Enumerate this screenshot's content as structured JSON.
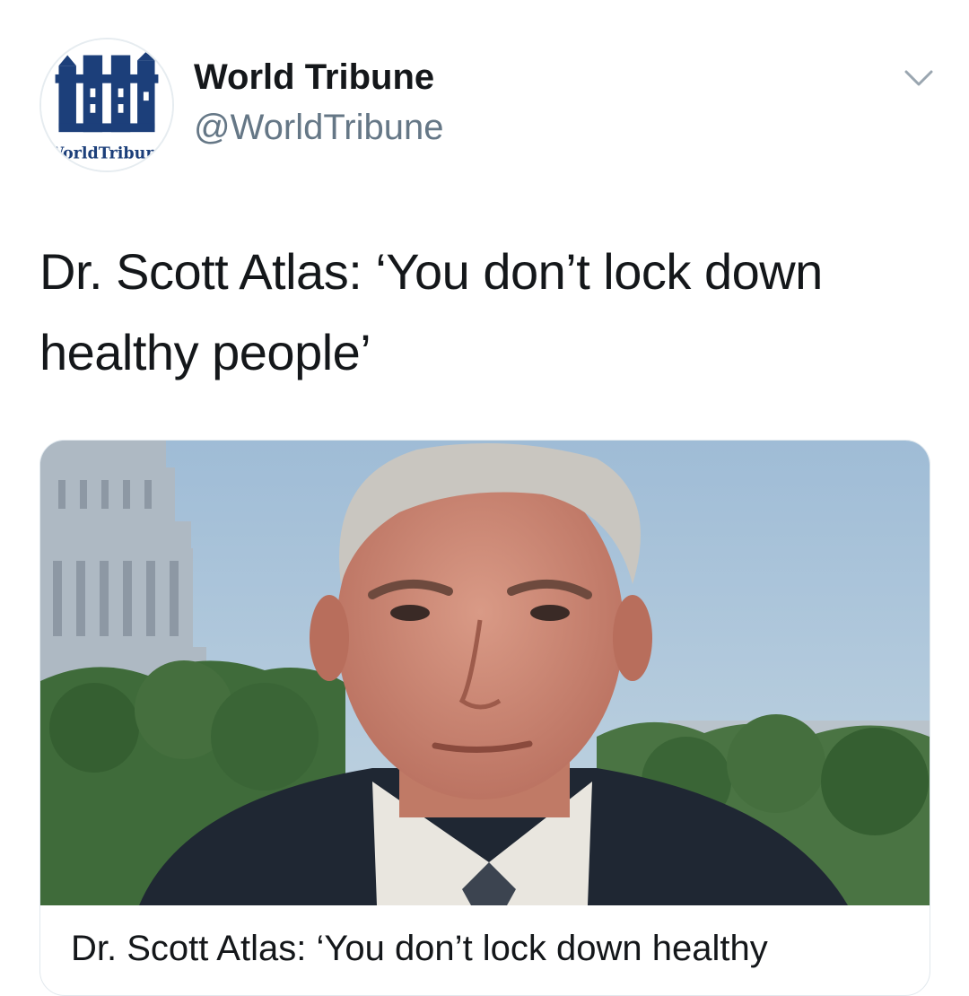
{
  "account": {
    "display_name": "World Tribune",
    "handle": "@WorldTribune",
    "avatar_icon": "world-tribune-logo",
    "logo_caption": "WorldTribune"
  },
  "menu_icon": "chevron-down-icon",
  "tweet": {
    "text": "Dr. Scott Atlas: ‘You don’t lock down healthy people’"
  },
  "card": {
    "image_icon": "article-photo",
    "title": "Dr. Scott Atlas: ‘You don’t lock down healthy"
  },
  "colors": {
    "text_primary": "#14171a",
    "text_secondary": "#657786",
    "logo_blue": "#1c3f7a",
    "card_border": "#e1e8ed"
  }
}
